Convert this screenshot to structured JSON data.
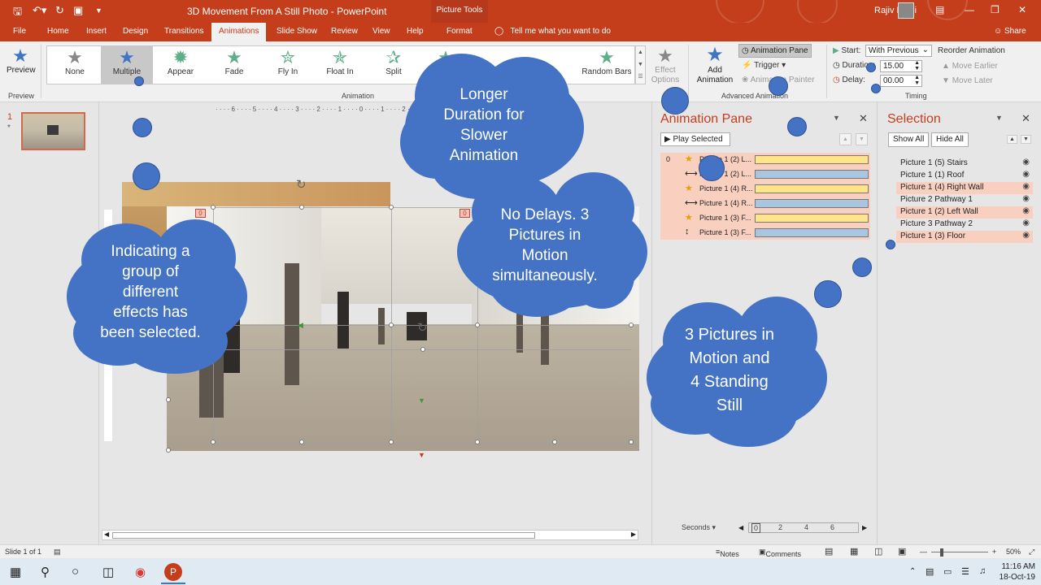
{
  "titlebar": {
    "title": "3D Movement From A Still Photo  -  PowerPoint",
    "context_tab": "Picture Tools",
    "user": "Rajiv Kohli",
    "minimize_icon": "minimize-icon",
    "restore_icon": "restore-icon",
    "close_icon": "close-icon"
  },
  "tabs": [
    "File",
    "Home",
    "Insert",
    "Design",
    "Transitions",
    "Animations",
    "Slide Show",
    "Review",
    "View",
    "Help",
    "Format"
  ],
  "tell_me": "Tell me what you want to do",
  "share": "Share",
  "ribbon": {
    "preview": "Preview",
    "preview_group": "Preview",
    "gallery": [
      "None",
      "Multiple",
      "Appear",
      "Fade",
      "Fly In",
      "Float In",
      "Split",
      "Random Bars"
    ],
    "animation_group": "Animation",
    "effect_options": "Effect\nOptions",
    "add_animation": "Add\nAnimation",
    "animation_pane": "Animation Pane",
    "trigger": "Trigger",
    "animation_painter": "Animation Painter",
    "advanced_group": "Advanced Animation",
    "start_label": "Start:",
    "start_value": "With Previous",
    "duration_label": "Duration:",
    "duration_value": "15.00",
    "delay_label": "Delay:",
    "delay_value": "00.00",
    "reorder": "Reorder Animation",
    "move_earlier": "Move Earlier",
    "move_later": "Move Later",
    "timing_group": "Timing"
  },
  "thumbs": {
    "number": "1",
    "marker": "*"
  },
  "slide": {
    "tag_left": "0",
    "tag_center": "0"
  },
  "animpane": {
    "title": "Animation Pane",
    "play_selected": "Play Selected",
    "rows": [
      {
        "idx": "0",
        "icon": "★",
        "name": "Picture 1 (2) L...",
        "bar": "y"
      },
      {
        "idx": "",
        "icon": "⟷",
        "name": "Picture 1 (2) L...",
        "bar": "b"
      },
      {
        "idx": "",
        "icon": "★",
        "name": "Picture 1 (4) R...",
        "bar": "y"
      },
      {
        "idx": "",
        "icon": "⟷",
        "name": "Picture 1 (4) R...",
        "bar": "b"
      },
      {
        "idx": "",
        "icon": "★",
        "name": "Picture 1 (3) F...",
        "bar": "y"
      },
      {
        "idx": "",
        "icon": "↕",
        "name": "Picture 1 (3) F...",
        "bar": "b"
      }
    ],
    "seconds": "Seconds",
    "scale": [
      "0",
      "2",
      "4",
      "6"
    ]
  },
  "selpane": {
    "title": "Selection",
    "show_all": "Show All",
    "hide_all": "Hide All",
    "items": [
      {
        "label": "Picture 1 (5) Stairs",
        "hl": false
      },
      {
        "label": "Picture 1 (1) Roof",
        "hl": false
      },
      {
        "label": "Picture 1 (4) Right Wall",
        "hl": true
      },
      {
        "label": "Picture 2 Pathway 1",
        "hl": false
      },
      {
        "label": "Picture 1 (2) Left Wall",
        "hl": true
      },
      {
        "label": "Picture 3 Pathway 2",
        "hl": false
      },
      {
        "label": "Picture 1 (3) Floor",
        "hl": true
      }
    ]
  },
  "callouts": {
    "duration": "Longer\nDuration for\nSlower\nAnimation",
    "no_delays": "No Delays. 3\nPictures in\nMotion\nsimultaneously.",
    "group": "Indicating a\ngroup of\ndifferent\neffects  has\nbeen selected.",
    "motion": "3 Pictures in\nMotion and\n4 Standing\nStill"
  },
  "status": {
    "slide": "Slide 1 of 1",
    "notes": "Notes",
    "comments": "Comments",
    "zoom": "50%"
  },
  "taskbar": {
    "time": "11:16 AM",
    "date": "18-Oct-19"
  },
  "colors": {
    "accent": "#c43e1c",
    "callout": "#4472c4",
    "highlight": "#f9cfbf"
  }
}
